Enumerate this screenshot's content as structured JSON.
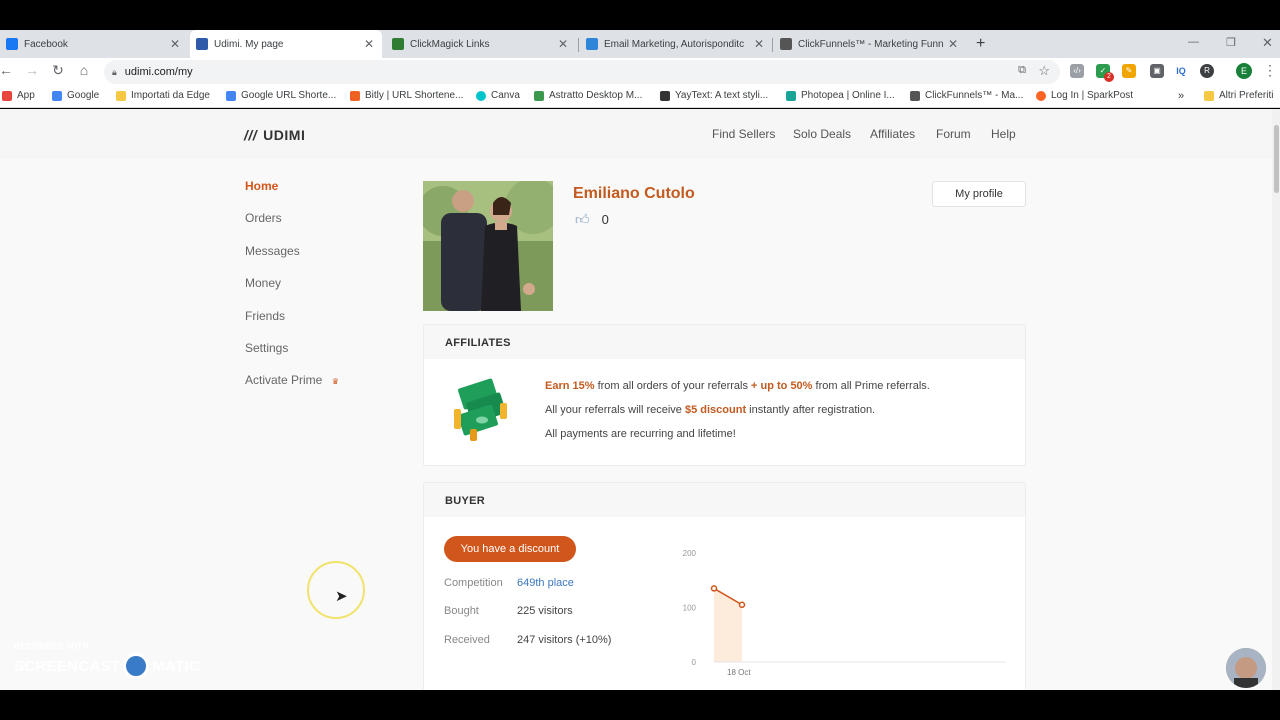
{
  "browser": {
    "tabs": [
      {
        "title": "Facebook",
        "active": false,
        "color": "#1877f2"
      },
      {
        "title": "Udimi. My page",
        "active": true,
        "color": "#2e5aa8"
      },
      {
        "title": "ClickMagick Links",
        "active": false,
        "color": "#2f7d32"
      },
      {
        "title": "Email Marketing, Autorisponditc",
        "active": false,
        "color": "#2d86d8"
      },
      {
        "title": "ClickFunnels™ - Marketing Funn",
        "active": false,
        "color": "#555555"
      }
    ],
    "new_tab": "+",
    "url": "udimi.com/my",
    "bookmarks": [
      {
        "label": "App",
        "color": "#e8453c"
      },
      {
        "label": "Google",
        "color": "#4285f4"
      },
      {
        "label": "Importati da Edge",
        "color": "#f6c844"
      },
      {
        "label": "Google URL Shorte...",
        "color": "#4285f4"
      },
      {
        "label": "Bitly | URL Shortene...",
        "color": "#ee6123"
      },
      {
        "label": "Canva",
        "color": "#00c4cc"
      },
      {
        "label": "Astratto Desktop M...",
        "color": "#3c9a4f"
      },
      {
        "label": "YayText: A text styli...",
        "color": "#333333"
      },
      {
        "label": "Photopea | Online I...",
        "color": "#18a497"
      },
      {
        "label": "ClickFunnels™ - Ma...",
        "color": "#555555"
      },
      {
        "label": "Log In | SparkPost",
        "color": "#fa6423"
      },
      {
        "label": "Altri Preferiti",
        "color": "#f6c844"
      }
    ],
    "bookmarks_overflow": "»",
    "ext_badge": "2",
    "ext_iq": "IQ",
    "profile_initial": "E"
  },
  "site": {
    "logo": "UDIMI",
    "nav": [
      "Find Sellers",
      "Solo Deals",
      "Affiliates",
      "Forum",
      "Help"
    ],
    "sidebar": [
      "Home",
      "Orders",
      "Messages",
      "Money",
      "Friends",
      "Settings",
      "Activate Prime"
    ],
    "sidebar_active": "Home"
  },
  "profile": {
    "name": "Emiliano Cutolo",
    "likes": "0",
    "my_profile_button": "My profile"
  },
  "affiliates": {
    "heading": "AFFILIATES",
    "line1_a": "Earn 15%",
    "line1_b": " from all orders of your referrals ",
    "line1_c": "+ up to 50%",
    "line1_d": " from all Prime referrals.",
    "line2_a": "All your referrals will receive ",
    "line2_b": "$5 discount",
    "line2_c": " instantly after registration.",
    "line3": "All payments are recurring and lifetime!"
  },
  "buyer": {
    "heading": "BUYER",
    "discount_button": "You have a discount",
    "stats": [
      {
        "key": "Competition",
        "value": "649th place",
        "link": true
      },
      {
        "key": "Bought",
        "value": "225 visitors",
        "link": false
      },
      {
        "key": "Received",
        "value": "247 visitors (+10%)",
        "link": false
      }
    ]
  },
  "chart_data": {
    "type": "line",
    "x": [
      "",
      "18 Oct"
    ],
    "series": [
      {
        "values": [
          135,
          105
        ]
      }
    ],
    "y_ticks": [
      "200",
      "100",
      "0"
    ],
    "x_tick_labels": [
      "18 Oct"
    ],
    "ylim": [
      0,
      200
    ],
    "color": "#d0561c",
    "fill": "#fdebdc",
    "grid": false
  },
  "overlay": {
    "watermark_top": "RECORDED WITH",
    "watermark_left": "SCREENCAST",
    "watermark_right": "MATIC"
  }
}
